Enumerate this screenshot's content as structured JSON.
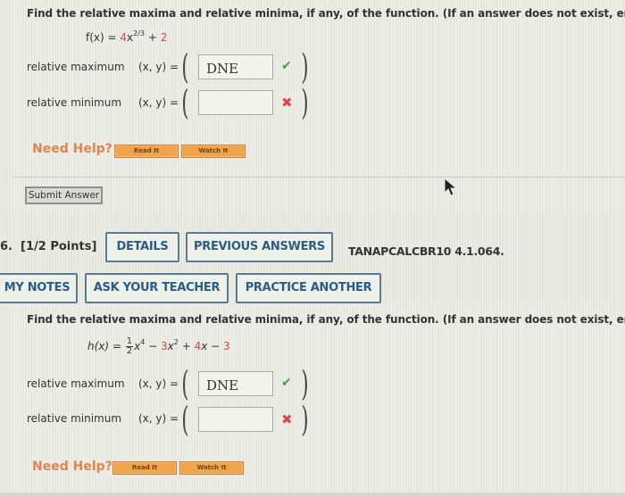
{
  "question1": {
    "prompt": "Find the relative maxima and relative minima, if any, of the function. (If an answer does not exist, enter DNE.)",
    "function": {
      "lhs": "f(x) = ",
      "coef": "4",
      "var": "x",
      "exponent": "2/3",
      "op": " + ",
      "const": "2"
    },
    "rows": [
      {
        "label": "relative maximum",
        "xy_label": "(x, y) =",
        "value": "DNE",
        "status": "correct"
      },
      {
        "label": "relative minimum",
        "xy_label": "(x, y) =",
        "value": "",
        "status": "incorrect"
      }
    ],
    "need_help": "Need Help?",
    "read_it": "Read It",
    "watch_it": "Watch It",
    "submit": "Submit Answer"
  },
  "question2": {
    "number": "6.",
    "points": "[1/2 Points]",
    "details": "DETAILS",
    "previous_answers": "PREVIOUS ANSWERS",
    "problem_id": "TANAPCALCBR10 4.1.064.",
    "my_notes": "MY NOTES",
    "ask_teacher": "ASK YOUR TEACHER",
    "practice_another": "PRACTICE ANOTHER",
    "prompt": "Find the relative maxima and relative minima, if any, of the function. (If an answer does not exist, enter DNE.)",
    "function": {
      "lhs": "h(x) = ",
      "frac_num": "1",
      "frac_den": "2",
      "term1": "x",
      "term1_exp": "4",
      "op1": " − ",
      "coef2": "3",
      "term2": "x",
      "term2_exp": "2",
      "op2": " + ",
      "coef3": "4",
      "term3": "x",
      "op3": " − ",
      "const": "3"
    },
    "rows": [
      {
        "label": "relative maximum",
        "xy_label": "(x, y) =",
        "value": "DNE",
        "status": "correct"
      },
      {
        "label": "relative minimum",
        "xy_label": "(x, y) =",
        "value": "",
        "status": "incorrect"
      }
    ],
    "need_help": "Need Help?",
    "read_it": "Read It",
    "watch_it": "Watch It"
  },
  "icons": {
    "check": "✔",
    "cross": "✖",
    "paren_open": "(",
    "paren_close": ")"
  }
}
